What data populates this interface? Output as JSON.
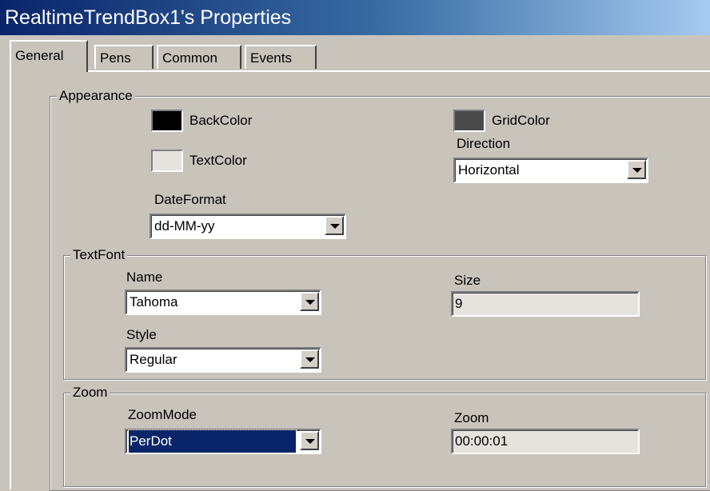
{
  "window": {
    "title": "RealtimeTrendBox1's Properties"
  },
  "tabs": [
    {
      "label": "General",
      "active": true
    },
    {
      "label": "Pens",
      "active": false
    },
    {
      "label": "Common",
      "active": false
    },
    {
      "label": "Events",
      "active": false
    }
  ],
  "appearance": {
    "legend": "Appearance",
    "back_color": {
      "label": "BackColor",
      "color": "#000000"
    },
    "text_color": {
      "label": "TextColor",
      "color": "#e6e3de"
    },
    "grid_color": {
      "label": "GridColor",
      "color": "#4a4a4a"
    },
    "direction": {
      "label": "Direction",
      "value": "Horizontal"
    },
    "date_format": {
      "label": "DateFormat",
      "value": "dd-MM-yy"
    }
  },
  "text_font": {
    "legend": "TextFont",
    "name": {
      "label": "Name",
      "value": "Tahoma"
    },
    "size": {
      "label": "Size",
      "value": "9"
    },
    "style": {
      "label": "Style",
      "value": "Regular"
    }
  },
  "zoom": {
    "legend": "Zoom",
    "zoom_mode": {
      "label": "ZoomMode",
      "value": "PerDot"
    },
    "zoom": {
      "label": "Zoom",
      "value": "00:00:01"
    }
  }
}
